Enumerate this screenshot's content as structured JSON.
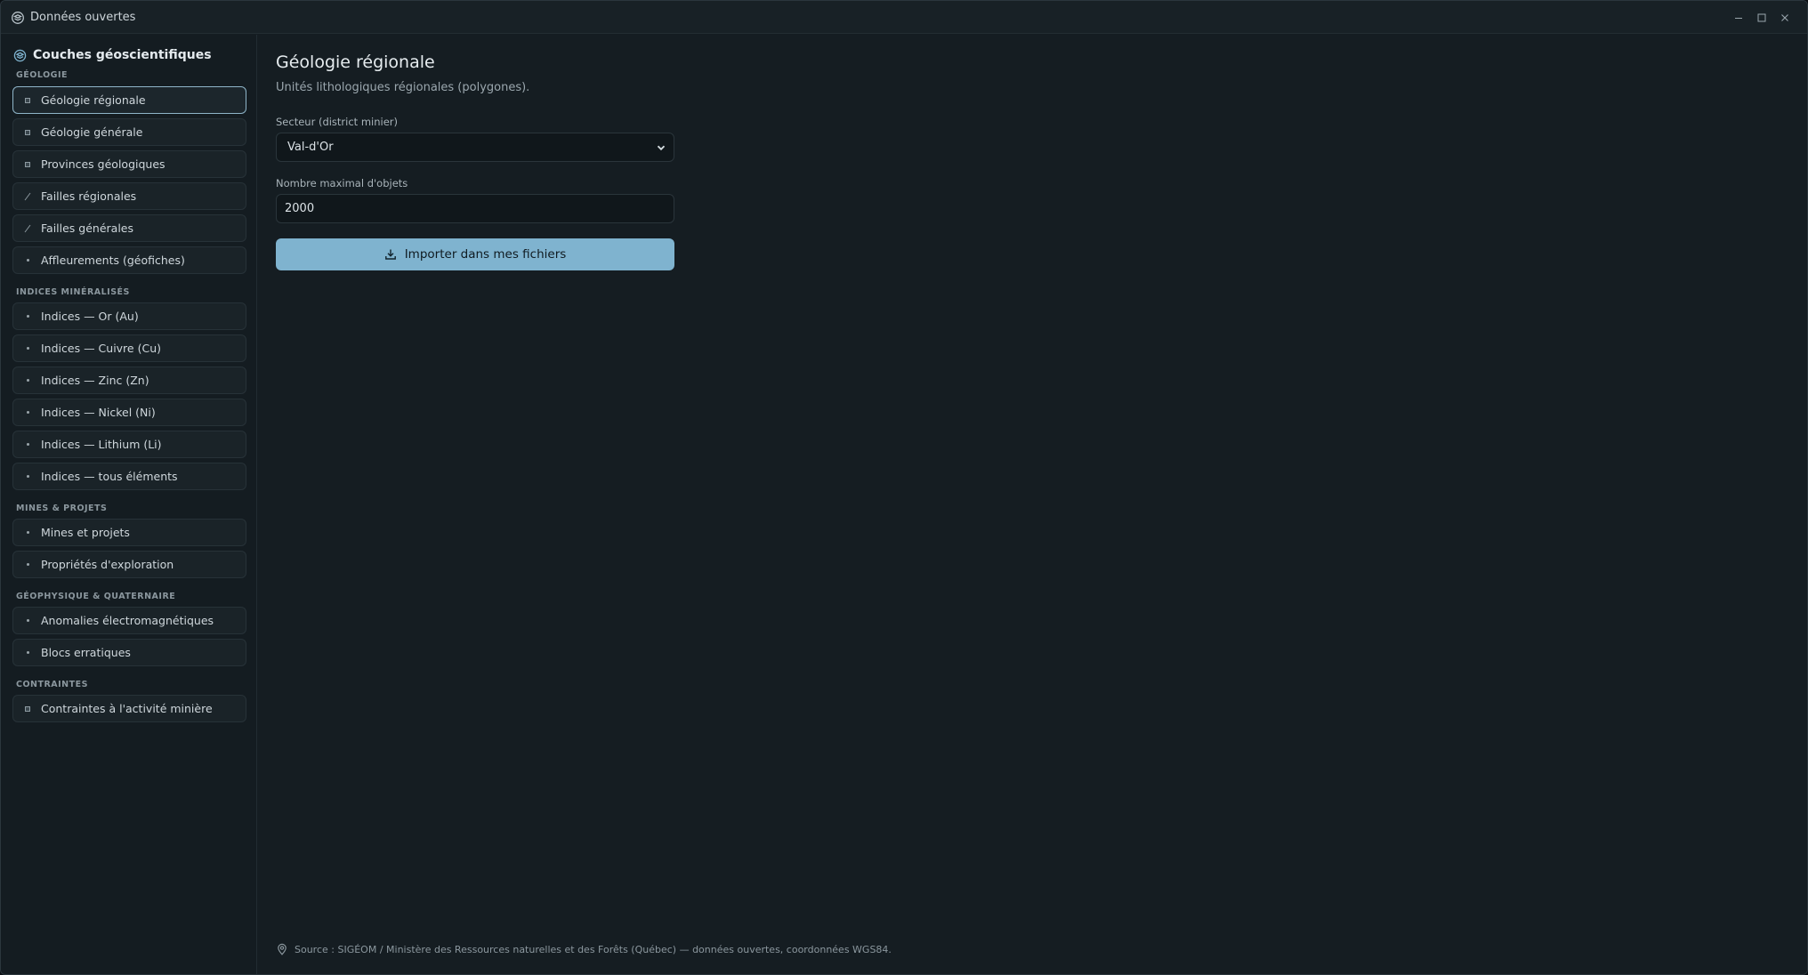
{
  "window": {
    "title": "Données ouvertes"
  },
  "sidebar": {
    "header": "Couches géoscientifiques",
    "sections": [
      {
        "label": "GÉOLOGIE",
        "items": [
          {
            "label": "Géologie régionale",
            "icon": "polygon-icon",
            "active": true
          },
          {
            "label": "Géologie générale",
            "icon": "polygon-icon"
          },
          {
            "label": "Provinces géologiques",
            "icon": "polygon-icon"
          },
          {
            "label": "Failles régionales",
            "icon": "line-icon"
          },
          {
            "label": "Failles générales",
            "icon": "line-icon"
          },
          {
            "label": "Affleurements (géofiches)",
            "icon": "point-icon"
          }
        ]
      },
      {
        "label": "INDICES MINÉRALISÉS",
        "items": [
          {
            "label": "Indices — Or (Au)",
            "icon": "point-icon"
          },
          {
            "label": "Indices — Cuivre (Cu)",
            "icon": "point-icon"
          },
          {
            "label": "Indices — Zinc (Zn)",
            "icon": "point-icon"
          },
          {
            "label": "Indices — Nickel (Ni)",
            "icon": "point-icon"
          },
          {
            "label": "Indices — Lithium (Li)",
            "icon": "point-icon"
          },
          {
            "label": "Indices — tous éléments",
            "icon": "point-icon"
          }
        ]
      },
      {
        "label": "MINES & PROJETS",
        "items": [
          {
            "label": "Mines et projets",
            "icon": "point-icon"
          },
          {
            "label": "Propriétés d'exploration",
            "icon": "point-icon"
          }
        ]
      },
      {
        "label": "GÉOPHYSIQUE & QUATERNAIRE",
        "items": [
          {
            "label": "Anomalies électromagnétiques",
            "icon": "point-icon"
          },
          {
            "label": "Blocs erratiques",
            "icon": "point-icon"
          }
        ]
      },
      {
        "label": "CONTRAINTES",
        "items": [
          {
            "label": "Contraintes à l'activité minière",
            "icon": "polygon-icon"
          }
        ]
      }
    ]
  },
  "main": {
    "title": "Géologie régionale",
    "subtitle": "Unités lithologiques régionales (polygones).",
    "sector": {
      "label": "Secteur (district minier)",
      "value": "Val-d'Or"
    },
    "max_objects": {
      "label": "Nombre maximal d'objets",
      "value": "2000"
    },
    "import_button": "Importer dans mes fichiers",
    "footer": "Source : SIGÉOM / Ministère des Ressources naturelles et des Forêts (Québec) — données ouvertes, coordonnées WGS84."
  },
  "colors": {
    "accent": "#7fb3cf",
    "background": "#151d22",
    "sidebar": "#141c21"
  }
}
